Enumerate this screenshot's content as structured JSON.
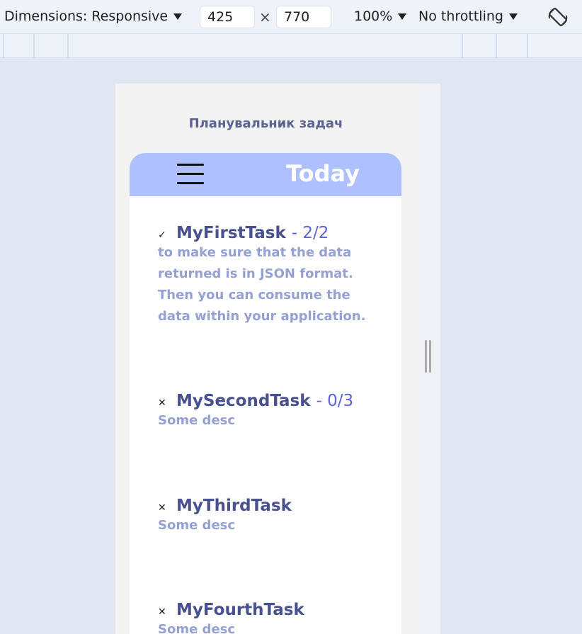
{
  "devtools": {
    "dimensions_label": "Dimensions: Responsive",
    "width_value": "425",
    "times_symbol": "×",
    "height_value": "770",
    "zoom_label": "100%",
    "throttling_label": "No throttling",
    "rotate_icon": "rotate-icon"
  },
  "app": {
    "title": "Планувальник задач",
    "header_title": "Today",
    "menu_icon": "hamburger-menu-icon"
  },
  "tasks": [
    {
      "status_mark": "✓",
      "name": "MyFirstTask",
      "count": "- 2/2",
      "description": "to make sure that the data returned is in JSON format. Then you can consume the data within your application."
    },
    {
      "status_mark": "✕",
      "name": "MySecondTask",
      "count": "- 0/3",
      "description": "Some desc"
    },
    {
      "status_mark": "✕",
      "name": "MyThirdTask",
      "count": "",
      "description": "Some desc"
    },
    {
      "status_mark": "✕",
      "name": "MyFourthTask",
      "count": "",
      "description": "Some desc"
    }
  ],
  "colors": {
    "header_bg": "#aec0ff",
    "title_text": "#5c6392",
    "task_name": "#49508f",
    "task_count": "#5a63e0",
    "task_desc": "#95a0d3",
    "page_bg": "#e1e6f3"
  }
}
